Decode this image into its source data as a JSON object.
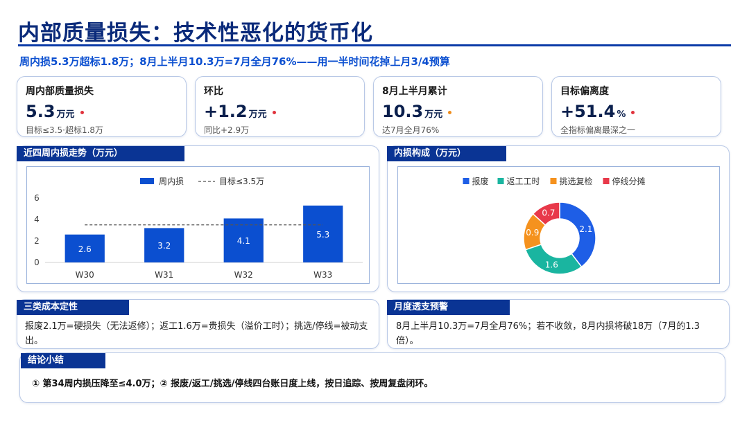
{
  "header": {
    "title": "内部质量损失：技术性恶化的货币化",
    "subtitle": "周内损5.3万超标1.8万；8月上半月10.3万=7月全月76%——用一半时间花掉上月3/4预算"
  },
  "kpis": [
    {
      "label": "周内部质量损失",
      "value": "5.3",
      "unit": "万元",
      "note": "目标≤3.5·超标1.8万",
      "dot_color": "#e0323c"
    },
    {
      "label": "环比",
      "value": "+1.2",
      "unit": "万元",
      "note": "同比+2.9万",
      "dot_color": "#e0323c"
    },
    {
      "label": "8月上半月累计",
      "value": "10.3",
      "unit": "万元",
      "note": "达7月全月76%",
      "dot_color": "#f08c1a"
    },
    {
      "label": "目标偏离度",
      "value": "+51.4",
      "unit": "%",
      "note": "全指标偏离最深之一",
      "dot_color": "#e0323c"
    }
  ],
  "panels": {
    "trend_title": "近四周内损走势（万元）",
    "composition_title": "内损构成（万元）",
    "cost_title": "三类成本定性",
    "cost_text": "报废2.1万=硬损失（无法返修）；返工1.6万=贵损失（溢价工时）；挑选/停线=被动支出。",
    "alert_title": "月度透支预警",
    "alert_text": "8月上半月10.3万=7月全月76%；若不收敛，8月内损将破18万（7月的1.3倍）。",
    "conclusion_title": "结论小结",
    "conclusion_text": "① 第34周内损压降至≤4.0万；② 报废/返工/挑选/停线四台账日度上线，按日追踪、按周复盘闭环。"
  },
  "chart_data": [
    {
      "type": "bar",
      "title": "近四周内损走势（万元）",
      "categories": [
        "W30",
        "W31",
        "W32",
        "W33"
      ],
      "series": [
        {
          "name": "周内损",
          "values": [
            2.6,
            3.2,
            4.1,
            5.3
          ]
        }
      ],
      "target": {
        "name": "目标≤3.5万",
        "value": 3.5
      },
      "ylim": [
        0,
        6
      ],
      "yticks": [
        0,
        2,
        4,
        6
      ],
      "grid": false,
      "legend": "top-center",
      "bar_color": "#0b4fd0"
    },
    {
      "type": "pie",
      "title": "内损构成（万元）",
      "donut": true,
      "slices": [
        {
          "name": "报废",
          "value": 2.1,
          "color": "#1e5ee6"
        },
        {
          "name": "返工工时",
          "value": 1.6,
          "color": "#1ab5a0"
        },
        {
          "name": "挑选复检",
          "value": 0.9,
          "color": "#f5921e"
        },
        {
          "name": "停线分摊",
          "value": 0.7,
          "color": "#e8394a"
        }
      ],
      "legend": "top-center"
    }
  ]
}
